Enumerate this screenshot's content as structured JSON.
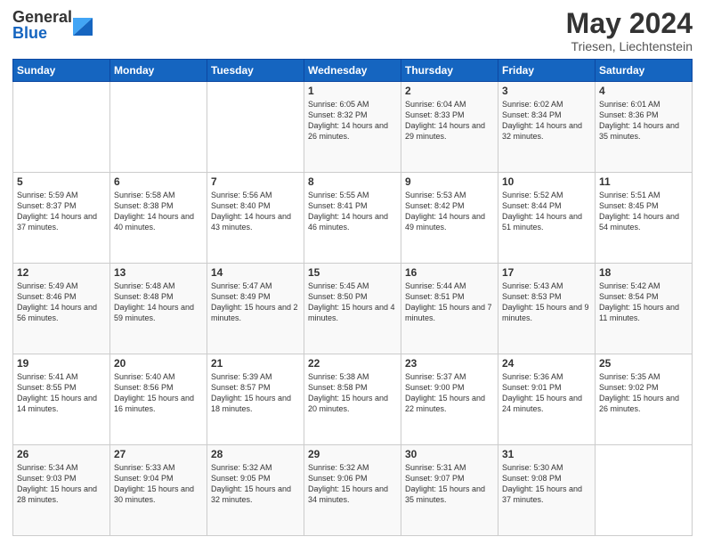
{
  "header": {
    "logo_general": "General",
    "logo_blue": "Blue",
    "month_year": "May 2024",
    "location": "Triesen, Liechtenstein"
  },
  "days_of_week": [
    "Sunday",
    "Monday",
    "Tuesday",
    "Wednesday",
    "Thursday",
    "Friday",
    "Saturday"
  ],
  "weeks": [
    [
      {
        "day": "",
        "sunrise": "",
        "sunset": "",
        "daylight": ""
      },
      {
        "day": "",
        "sunrise": "",
        "sunset": "",
        "daylight": ""
      },
      {
        "day": "",
        "sunrise": "",
        "sunset": "",
        "daylight": ""
      },
      {
        "day": "1",
        "sunrise": "Sunrise: 6:05 AM",
        "sunset": "Sunset: 8:32 PM",
        "daylight": "Daylight: 14 hours and 26 minutes."
      },
      {
        "day": "2",
        "sunrise": "Sunrise: 6:04 AM",
        "sunset": "Sunset: 8:33 PM",
        "daylight": "Daylight: 14 hours and 29 minutes."
      },
      {
        "day": "3",
        "sunrise": "Sunrise: 6:02 AM",
        "sunset": "Sunset: 8:34 PM",
        "daylight": "Daylight: 14 hours and 32 minutes."
      },
      {
        "day": "4",
        "sunrise": "Sunrise: 6:01 AM",
        "sunset": "Sunset: 8:36 PM",
        "daylight": "Daylight: 14 hours and 35 minutes."
      }
    ],
    [
      {
        "day": "5",
        "sunrise": "Sunrise: 5:59 AM",
        "sunset": "Sunset: 8:37 PM",
        "daylight": "Daylight: 14 hours and 37 minutes."
      },
      {
        "day": "6",
        "sunrise": "Sunrise: 5:58 AM",
        "sunset": "Sunset: 8:38 PM",
        "daylight": "Daylight: 14 hours and 40 minutes."
      },
      {
        "day": "7",
        "sunrise": "Sunrise: 5:56 AM",
        "sunset": "Sunset: 8:40 PM",
        "daylight": "Daylight: 14 hours and 43 minutes."
      },
      {
        "day": "8",
        "sunrise": "Sunrise: 5:55 AM",
        "sunset": "Sunset: 8:41 PM",
        "daylight": "Daylight: 14 hours and 46 minutes."
      },
      {
        "day": "9",
        "sunrise": "Sunrise: 5:53 AM",
        "sunset": "Sunset: 8:42 PM",
        "daylight": "Daylight: 14 hours and 49 minutes."
      },
      {
        "day": "10",
        "sunrise": "Sunrise: 5:52 AM",
        "sunset": "Sunset: 8:44 PM",
        "daylight": "Daylight: 14 hours and 51 minutes."
      },
      {
        "day": "11",
        "sunrise": "Sunrise: 5:51 AM",
        "sunset": "Sunset: 8:45 PM",
        "daylight": "Daylight: 14 hours and 54 minutes."
      }
    ],
    [
      {
        "day": "12",
        "sunrise": "Sunrise: 5:49 AM",
        "sunset": "Sunset: 8:46 PM",
        "daylight": "Daylight: 14 hours and 56 minutes."
      },
      {
        "day": "13",
        "sunrise": "Sunrise: 5:48 AM",
        "sunset": "Sunset: 8:48 PM",
        "daylight": "Daylight: 14 hours and 59 minutes."
      },
      {
        "day": "14",
        "sunrise": "Sunrise: 5:47 AM",
        "sunset": "Sunset: 8:49 PM",
        "daylight": "Daylight: 15 hours and 2 minutes."
      },
      {
        "day": "15",
        "sunrise": "Sunrise: 5:45 AM",
        "sunset": "Sunset: 8:50 PM",
        "daylight": "Daylight: 15 hours and 4 minutes."
      },
      {
        "day": "16",
        "sunrise": "Sunrise: 5:44 AM",
        "sunset": "Sunset: 8:51 PM",
        "daylight": "Daylight: 15 hours and 7 minutes."
      },
      {
        "day": "17",
        "sunrise": "Sunrise: 5:43 AM",
        "sunset": "Sunset: 8:53 PM",
        "daylight": "Daylight: 15 hours and 9 minutes."
      },
      {
        "day": "18",
        "sunrise": "Sunrise: 5:42 AM",
        "sunset": "Sunset: 8:54 PM",
        "daylight": "Daylight: 15 hours and 11 minutes."
      }
    ],
    [
      {
        "day": "19",
        "sunrise": "Sunrise: 5:41 AM",
        "sunset": "Sunset: 8:55 PM",
        "daylight": "Daylight: 15 hours and 14 minutes."
      },
      {
        "day": "20",
        "sunrise": "Sunrise: 5:40 AM",
        "sunset": "Sunset: 8:56 PM",
        "daylight": "Daylight: 15 hours and 16 minutes."
      },
      {
        "day": "21",
        "sunrise": "Sunrise: 5:39 AM",
        "sunset": "Sunset: 8:57 PM",
        "daylight": "Daylight: 15 hours and 18 minutes."
      },
      {
        "day": "22",
        "sunrise": "Sunrise: 5:38 AM",
        "sunset": "Sunset: 8:58 PM",
        "daylight": "Daylight: 15 hours and 20 minutes."
      },
      {
        "day": "23",
        "sunrise": "Sunrise: 5:37 AM",
        "sunset": "Sunset: 9:00 PM",
        "daylight": "Daylight: 15 hours and 22 minutes."
      },
      {
        "day": "24",
        "sunrise": "Sunrise: 5:36 AM",
        "sunset": "Sunset: 9:01 PM",
        "daylight": "Daylight: 15 hours and 24 minutes."
      },
      {
        "day": "25",
        "sunrise": "Sunrise: 5:35 AM",
        "sunset": "Sunset: 9:02 PM",
        "daylight": "Daylight: 15 hours and 26 minutes."
      }
    ],
    [
      {
        "day": "26",
        "sunrise": "Sunrise: 5:34 AM",
        "sunset": "Sunset: 9:03 PM",
        "daylight": "Daylight: 15 hours and 28 minutes."
      },
      {
        "day": "27",
        "sunrise": "Sunrise: 5:33 AM",
        "sunset": "Sunset: 9:04 PM",
        "daylight": "Daylight: 15 hours and 30 minutes."
      },
      {
        "day": "28",
        "sunrise": "Sunrise: 5:32 AM",
        "sunset": "Sunset: 9:05 PM",
        "daylight": "Daylight: 15 hours and 32 minutes."
      },
      {
        "day": "29",
        "sunrise": "Sunrise: 5:32 AM",
        "sunset": "Sunset: 9:06 PM",
        "daylight": "Daylight: 15 hours and 34 minutes."
      },
      {
        "day": "30",
        "sunrise": "Sunrise: 5:31 AM",
        "sunset": "Sunset: 9:07 PM",
        "daylight": "Daylight: 15 hours and 35 minutes."
      },
      {
        "day": "31",
        "sunrise": "Sunrise: 5:30 AM",
        "sunset": "Sunset: 9:08 PM",
        "daylight": "Daylight: 15 hours and 37 minutes."
      },
      {
        "day": "",
        "sunrise": "",
        "sunset": "",
        "daylight": ""
      }
    ]
  ]
}
